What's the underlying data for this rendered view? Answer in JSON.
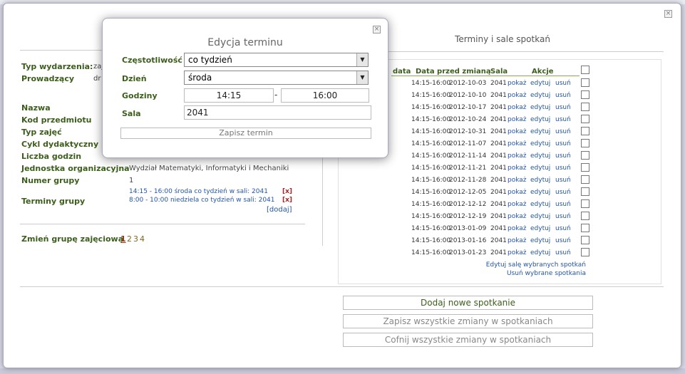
{
  "left": {
    "labels": [
      "Typ wydarzenia:",
      "Prowadzący",
      "Nazwa",
      "Kod przedmiotu",
      "Typ zajęć",
      "Cykl dydaktyczny",
      "Liczba godzin",
      "Jednostka organizacyjna",
      "Numer grupy",
      "Terminy grupy"
    ],
    "typ_value": "zaj",
    "prowadzacy_value": "dr",
    "jednostka_value": "Wydział Matematyki, Informatyki i Mechaniki",
    "numer_grupy_value": "1",
    "term1": "14:15 - 16:00 środa co tydzień w sali: 2041",
    "term2": "8:00 - 10:00 niedziela co tydzień w sali: 2041",
    "delete_label": "[x]",
    "add_link": "[dodaj]",
    "zmien_label": "Zmień grupę zajęciową",
    "pages": [
      "1",
      "2",
      "3",
      "4"
    ]
  },
  "right": {
    "title": "Terminy i sale spotkań",
    "headers": [
      "data",
      "Data przed zmianą",
      "Sala",
      "Akcje"
    ],
    "rows": [
      {
        "time": "14:15-16:00",
        "date": "2012-10-03"
      },
      {
        "time": "14:15-16:00",
        "date": "2012-10-10"
      },
      {
        "time": "14:15-16:00",
        "date": "2012-10-17"
      },
      {
        "time": "14:15-16:00",
        "date": "2012-10-24"
      },
      {
        "time": "14:15-16:00",
        "date": "2012-10-31"
      },
      {
        "time": "14:15-16:00",
        "date": "2012-11-07"
      },
      {
        "time": "14:15-16:00",
        "date": "2012-11-14"
      },
      {
        "time": "14:15-16:00",
        "date": "2012-11-21"
      },
      {
        "time": "14:15-16:00",
        "date": "2012-11-28"
      },
      {
        "time": "14:15-16:00",
        "date": "2012-12-05"
      },
      {
        "time": "14:15-16:00",
        "date": "2012-12-12"
      },
      {
        "time": "14:15-16:00",
        "date": "2012-12-19"
      },
      {
        "time": "14:15-16:00",
        "date": "2013-01-09"
      },
      {
        "time": "14:15-16:00",
        "date": "2013-01-16"
      },
      {
        "time": "14:15-16:00",
        "date": "2013-01-23"
      }
    ],
    "room": "2041",
    "action_show": "pokaż",
    "action_edit": "edytuj",
    "action_delete": "usuń",
    "edit_selected": "Edytuj salę wybranych spotkań",
    "delete_selected": "Usuń wybrane spotkania",
    "btn_add": "Dodaj nowe spotkanie",
    "btn_save_all": "Zapisz wszystkie zmiany w spotkaniach",
    "btn_revert_all": "Cofnij wszystkie zmiany w spotkaniach"
  },
  "dialog": {
    "title": "Edycja terminu",
    "labels": [
      "Częstotliwość",
      "Dzień",
      "Godziny",
      "Sala"
    ],
    "frequency": "co tydzień",
    "day": "środa",
    "time_from": "14:15",
    "time_sep": "-",
    "time_to": "16:00",
    "room": "2041",
    "save_label": "Zapisz termin"
  },
  "icons": {
    "close": "close-icon",
    "dropdown": "chevron-down-icon",
    "checkbox": "checkbox"
  }
}
